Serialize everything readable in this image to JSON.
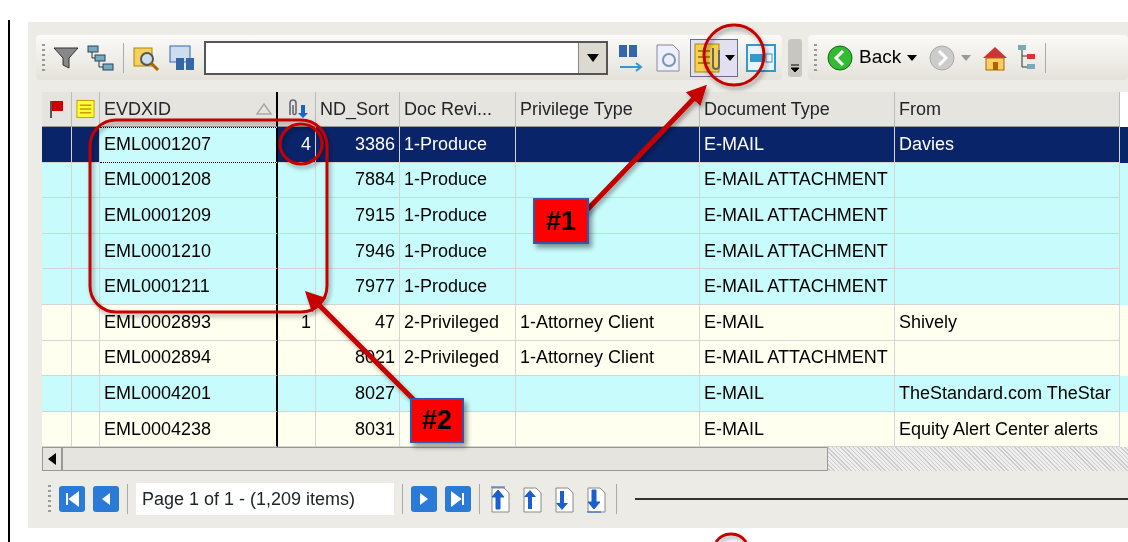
{
  "toolbar": {
    "attachment_view": {
      "pressed": true
    },
    "back_label": "Back"
  },
  "table": {
    "columns": [
      {
        "kind": "flag"
      },
      {
        "kind": "note"
      },
      {
        "kind": "text",
        "label": "EVDXID",
        "sorted": true
      },
      {
        "kind": "attachment"
      },
      {
        "kind": "text",
        "label": "ND_Sort",
        "sorted": false
      },
      {
        "kind": "text",
        "label": "Doc Revi...",
        "sorted": false
      },
      {
        "kind": "text",
        "label": "Privilege Type",
        "sorted": false
      },
      {
        "kind": "text",
        "label": "Document Type",
        "sorted": false
      },
      {
        "kind": "text",
        "label": "From",
        "sorted": false
      }
    ],
    "rows": [
      {
        "selected": true,
        "color": "#c8fcfc",
        "evdxid": "EML0001207",
        "attachments": "4",
        "nd_sort": "3386",
        "doc_review": "1-Produce",
        "document_type": "E-MAIL",
        "from": "Davies"
      },
      {
        "selected": false,
        "color": "#c8fcfc",
        "evdxid": "EML0001208",
        "nd_sort": "7884",
        "doc_review": "1-Produce",
        "document_type": "E-MAIL ATTACHMENT"
      },
      {
        "selected": false,
        "color": "#c8fcfc",
        "evdxid": "EML0001209",
        "nd_sort": "7915",
        "doc_review": "1-Produce",
        "document_type": "E-MAIL ATTACHMENT"
      },
      {
        "selected": false,
        "color": "#c8fcfc",
        "evdxid": "EML0001210",
        "nd_sort": "7946",
        "doc_review": "1-Produce",
        "document_type": "E-MAIL ATTACHMENT"
      },
      {
        "selected": false,
        "color": "#c8fcfc",
        "evdxid": "EML0001211",
        "nd_sort": "7977",
        "doc_review": "1-Produce",
        "document_type": "E-MAIL ATTACHMENT"
      },
      {
        "selected": false,
        "color": "#fffff0",
        "evdxid": "EML0002893",
        "attachments": "1",
        "nd_sort": "47",
        "doc_review": "2-Privileged",
        "privilege_type": "1-Attorney Client",
        "document_type": "E-MAIL",
        "from": "Shively"
      },
      {
        "selected": false,
        "color": "#fffff0",
        "evdxid": "EML0002894",
        "nd_sort": "8021",
        "doc_review": "2-Privileged",
        "privilege_type": "1-Attorney Client",
        "document_type": "E-MAIL ATTACHMENT"
      },
      {
        "selected": false,
        "color": "#c8fcfc",
        "evdxid": "EML0004201",
        "nd_sort": "8027",
        "document_type": "E-MAIL",
        "from": "TheStandard.com TheStar"
      },
      {
        "selected": false,
        "color": "#fffff0",
        "evdxid": "EML0004238",
        "nd_sort": "8031",
        "document_type": "E-MAIL",
        "from": "Equity Alert Center alerts"
      }
    ]
  },
  "pager": {
    "status": "Page 1 of 1 - (1,209 items)"
  },
  "callouts": [
    {
      "label": "#1"
    },
    {
      "label": "#2"
    }
  ]
}
